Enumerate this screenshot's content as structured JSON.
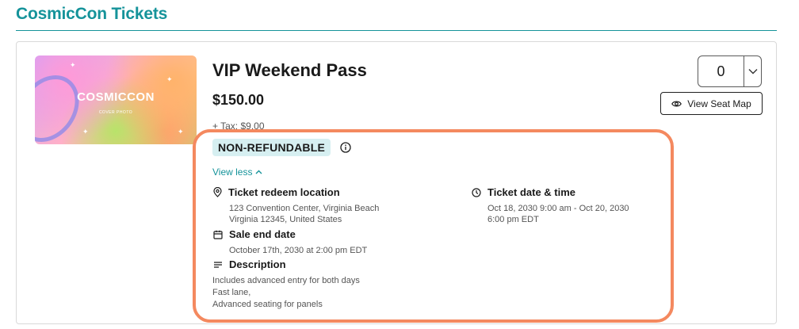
{
  "header": {
    "title": "CosmicCon Tickets"
  },
  "ticket": {
    "cover": {
      "title": "COSMICCON",
      "subtitle": "COVER PHOTO"
    },
    "name": "VIP Weekend Pass",
    "price": "$150.00",
    "tax": "+ Tax: $9.00",
    "quantity": "0",
    "view_seat_map": "View Seat Map",
    "refund_badge": "NON-REFUNDABLE",
    "toggle_details": "View less",
    "details": {
      "location": {
        "heading": "Ticket redeem location",
        "line1": "123 Convention Center, Virginia Beach",
        "line2": "Virginia 12345, United States"
      },
      "datetime": {
        "heading": "Ticket date & time",
        "line1": "Oct 18, 2030 9:00 am - Oct 20, 2030",
        "line2": "6:00 pm EDT"
      },
      "sale_end": {
        "heading": "Sale end date",
        "line1": "October 17th, 2030 at 2:00 pm EDT"
      },
      "description": {
        "heading": "Description",
        "lines": [
          "Includes advanced entry for both days",
          "Fast lane,",
          "Advanced seating for panels"
        ]
      }
    }
  },
  "colors": {
    "brand": "#15939a",
    "highlight": "#f4895f",
    "badge_bg": "#d6eff1"
  }
}
